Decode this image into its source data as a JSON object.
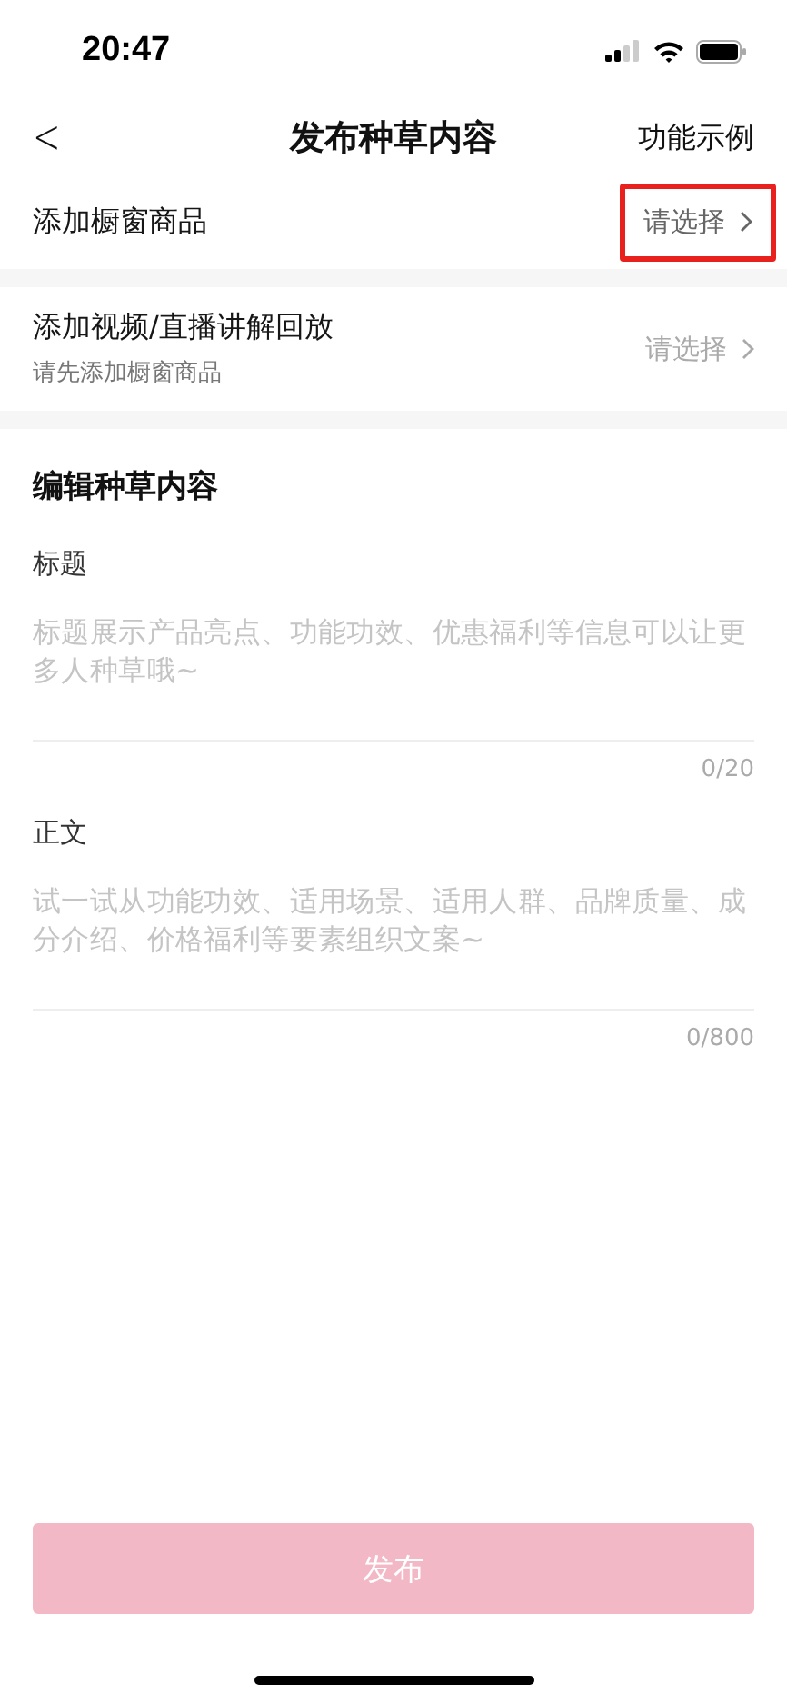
{
  "status_bar": {
    "time": "20:47"
  },
  "nav": {
    "back_icon": "<",
    "title": "发布种草内容",
    "action": "功能示例"
  },
  "rows": [
    {
      "label": "添加橱窗商品",
      "value": "请选择",
      "disabled": false,
      "highlighted": true
    },
    {
      "label": "添加视频/直播讲解回放",
      "sublabel": "请先添加橱窗商品",
      "value": "请选择",
      "disabled": true,
      "highlighted": false
    }
  ],
  "editor": {
    "heading": "编辑种草内容",
    "fields": [
      {
        "label": "标题",
        "placeholder": "标题展示产品亮点、功能功效、优惠福利等信息可以让更多人种草哦~",
        "count": "0/20"
      },
      {
        "label": "正文",
        "placeholder": "试一试从功能功效、适用场景、适用人群、品牌质量、成分介绍、价格福利等要素组织文案~",
        "count": "0/800"
      }
    ]
  },
  "publish_button": {
    "label": "发布",
    "disabled": true
  }
}
